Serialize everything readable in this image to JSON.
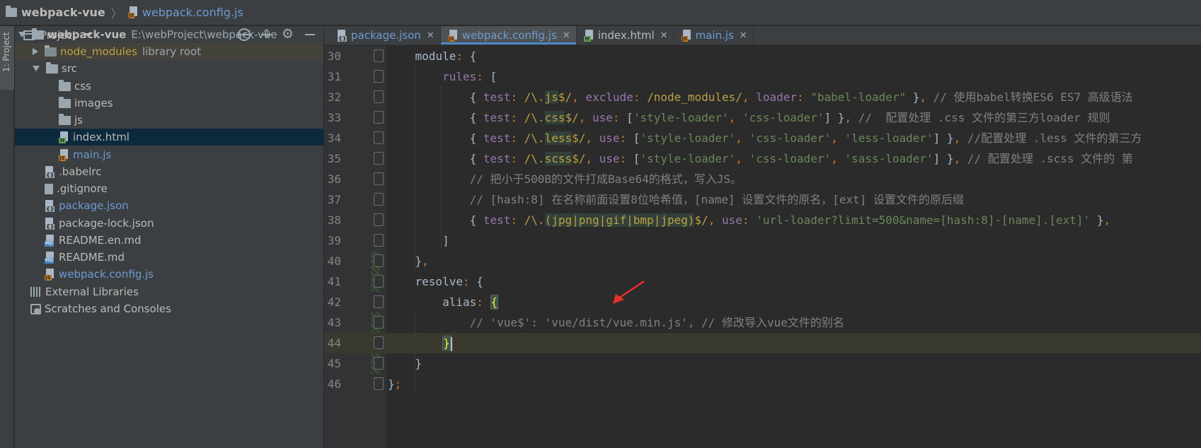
{
  "navbar": {
    "project": "webpack-vue",
    "file": "webpack.config.js"
  },
  "left_stripe": {
    "project_tab": "1: Project"
  },
  "project_panel": {
    "title": "Project",
    "tree": [
      {
        "label": "webpack-vue",
        "hint": "E:\\webProject\\webpack-vue",
        "icon": "folder-icon",
        "expanded": true,
        "level": 0
      },
      {
        "label": "node_modules",
        "hint": "library root",
        "icon": "excluded-folder-icon",
        "expanded": false,
        "level": 1
      },
      {
        "label": "src",
        "icon": "folder-icon",
        "expanded": true,
        "level": 1
      },
      {
        "label": "css",
        "icon": "folder-icon",
        "level": 2
      },
      {
        "label": "images",
        "icon": "folder-icon",
        "level": 2
      },
      {
        "label": "js",
        "icon": "folder-icon",
        "level": 2
      },
      {
        "label": "index.html",
        "icon": "html-file-icon",
        "level": 2,
        "selected": true
      },
      {
        "label": "main.js",
        "icon": "js-file-icon",
        "level": 2
      },
      {
        "label": ".babelrc",
        "icon": "json-file-icon",
        "level": 1
      },
      {
        "label": ".gitignore",
        "icon": "text-file-icon",
        "level": 1
      },
      {
        "label": "package.json",
        "icon": "json-file-icon",
        "level": 1
      },
      {
        "label": "package-lock.json",
        "icon": "json-file-icon",
        "level": 1
      },
      {
        "label": "README.en.md",
        "icon": "markdown-file-icon",
        "level": 1
      },
      {
        "label": "README.md",
        "icon": "markdown-file-icon",
        "level": 1
      },
      {
        "label": "webpack.config.js",
        "icon": "js-file-icon",
        "level": 1
      },
      {
        "label": "External Libraries",
        "icon": "libraries-icon",
        "level": 0
      },
      {
        "label": "Scratches and Consoles",
        "icon": "scratches-icon",
        "level": 0
      }
    ]
  },
  "editor": {
    "tabs": [
      {
        "label": "package.json",
        "icon": "json-file-icon",
        "active": false
      },
      {
        "label": "webpack.config.js",
        "icon": "js-file-icon",
        "active": true
      },
      {
        "label": "index.html",
        "icon": "html-file-icon",
        "active": false
      },
      {
        "label": "main.js",
        "icon": "js-file-icon",
        "active": false
      }
    ],
    "current_line": 44,
    "lines": [
      {
        "n": "30",
        "t": [
          [
            "",
            "    module"
          ],
          [
            "kw",
            ": "
          ],
          [
            "",
            "{"
          ]
        ]
      },
      {
        "n": "31",
        "t": [
          [
            "",
            "        "
          ],
          [
            "pr",
            "rules"
          ],
          [
            "kw",
            ": "
          ],
          [
            "",
            "["
          ]
        ]
      },
      {
        "n": "32",
        "t": [
          [
            "",
            "            { "
          ],
          [
            "pr",
            "test"
          ],
          [
            "kw",
            ": "
          ],
          [
            "rgx",
            "/\\."
          ],
          [
            "rgx-bg",
            "js"
          ],
          [
            "rgx",
            "$/"
          ],
          [
            "kw",
            ", "
          ],
          [
            "pr",
            "exclude"
          ],
          [
            "kw",
            ": "
          ],
          [
            "rgx",
            "/node_modules/"
          ],
          [
            "kw",
            ", "
          ],
          [
            "pr",
            "loader"
          ],
          [
            "kw",
            ": "
          ],
          [
            "str",
            "\"babel-loader\""
          ],
          [
            "",
            " }"
          ],
          [
            "kw",
            ", "
          ],
          [
            "cm",
            "// 使用babel转换ES6 ES7 高级语法"
          ]
        ]
      },
      {
        "n": "33",
        "t": [
          [
            "",
            "            { "
          ],
          [
            "pr",
            "test"
          ],
          [
            "kw",
            ": "
          ],
          [
            "rgx",
            "/\\."
          ],
          [
            "rgx-bg",
            "css"
          ],
          [
            "rgx",
            "$/"
          ],
          [
            "kw",
            ", "
          ],
          [
            "pr",
            "use"
          ],
          [
            "kw",
            ": "
          ],
          [
            "",
            "["
          ],
          [
            "str",
            "'style-loader'"
          ],
          [
            "kw",
            ", "
          ],
          [
            "str",
            "'css-loader'"
          ],
          [
            "",
            "] }"
          ],
          [
            "kw",
            ", "
          ],
          [
            "cm",
            "//  配置处理 .css 文件的第三方loader 规则"
          ]
        ]
      },
      {
        "n": "34",
        "t": [
          [
            "",
            "            { "
          ],
          [
            "pr",
            "test"
          ],
          [
            "kw",
            ": "
          ],
          [
            "rgx",
            "/\\."
          ],
          [
            "rgx-bg",
            "less"
          ],
          [
            "rgx",
            "$/"
          ],
          [
            "kw",
            ", "
          ],
          [
            "pr",
            "use"
          ],
          [
            "kw",
            ": "
          ],
          [
            "",
            "["
          ],
          [
            "str",
            "'style-loader'"
          ],
          [
            "kw",
            ", "
          ],
          [
            "str",
            "'css-loader'"
          ],
          [
            "kw",
            ", "
          ],
          [
            "str",
            "'less-loader'"
          ],
          [
            "",
            "] }"
          ],
          [
            "kw",
            ", "
          ],
          [
            "cm",
            "//配置处理 .less 文件的第三方"
          ]
        ]
      },
      {
        "n": "35",
        "t": [
          [
            "",
            "            { "
          ],
          [
            "pr",
            "test"
          ],
          [
            "kw",
            ": "
          ],
          [
            "rgx",
            "/\\."
          ],
          [
            "rgx-bg",
            "scss"
          ],
          [
            "rgx",
            "$/"
          ],
          [
            "kw",
            ", "
          ],
          [
            "pr",
            "use"
          ],
          [
            "kw",
            ": "
          ],
          [
            "",
            "["
          ],
          [
            "str",
            "'style-loader'"
          ],
          [
            "kw",
            ", "
          ],
          [
            "str",
            "'css-loader'"
          ],
          [
            "kw",
            ", "
          ],
          [
            "str",
            "'sass-loader'"
          ],
          [
            "",
            "] }"
          ],
          [
            "kw",
            ", "
          ],
          [
            "cm",
            "// 配置处理 .scss 文件的 第"
          ]
        ]
      },
      {
        "n": "36",
        "t": [
          [
            "",
            "            "
          ],
          [
            "cm",
            "// 把小于500B的文件打成Base64的格式，写入JS。"
          ]
        ]
      },
      {
        "n": "37",
        "t": [
          [
            "",
            "            "
          ],
          [
            "cm",
            "// [hash:8] 在名称前面设置8位哈希值，[name] 设置文件的原名，[ext] 设置文件的原后缀"
          ]
        ]
      },
      {
        "n": "38",
        "t": [
          [
            "",
            "            { "
          ],
          [
            "pr",
            "test"
          ],
          [
            "kw",
            ": "
          ],
          [
            "rgx",
            "/\\."
          ],
          [
            "rgx-bg",
            "(jpg|png|gif|bmp|jpeg)"
          ],
          [
            "rgx",
            "$/"
          ],
          [
            "kw",
            ", "
          ],
          [
            "pr",
            "use"
          ],
          [
            "kw",
            ": "
          ],
          [
            "str",
            "'url-loader?limit=500&name=[hash:8]-[name].[ext]'"
          ],
          [
            "",
            " }"
          ],
          [
            "kw",
            ","
          ]
        ]
      },
      {
        "n": "39",
        "t": [
          [
            "",
            "        ]"
          ]
        ]
      },
      {
        "n": "40",
        "t": [
          [
            "",
            "    }"
          ],
          [
            "kw",
            ","
          ]
        ]
      },
      {
        "n": "41",
        "t": [
          [
            "",
            "    resolve"
          ],
          [
            "kw",
            ": "
          ],
          [
            "",
            "{"
          ]
        ]
      },
      {
        "n": "42",
        "t": [
          [
            "",
            "        alias"
          ],
          [
            "kw",
            ": "
          ],
          [
            "brace-hl",
            "{"
          ]
        ]
      },
      {
        "n": "43",
        "t": [
          [
            "",
            "            "
          ],
          [
            "cm",
            "// 'vue$': 'vue/dist/vue.min.js', // 修改导入vue文件的别名"
          ]
        ]
      },
      {
        "n": "44",
        "t": [
          [
            "",
            "        "
          ],
          [
            "brace-hl",
            "}"
          ],
          [
            "cursor",
            ""
          ]
        ]
      },
      {
        "n": "45",
        "t": [
          [
            "",
            "    }"
          ]
        ]
      },
      {
        "n": "46",
        "t": [
          [
            "",
            "}"
          ],
          [
            "kw",
            ";"
          ]
        ]
      }
    ]
  },
  "colors": {
    "keyword": "#cc7832",
    "property": "#9876aa",
    "string": "#6a8759",
    "regex": "#b9a243",
    "comment": "#808080",
    "annotation_arrow": "#e8302a"
  }
}
